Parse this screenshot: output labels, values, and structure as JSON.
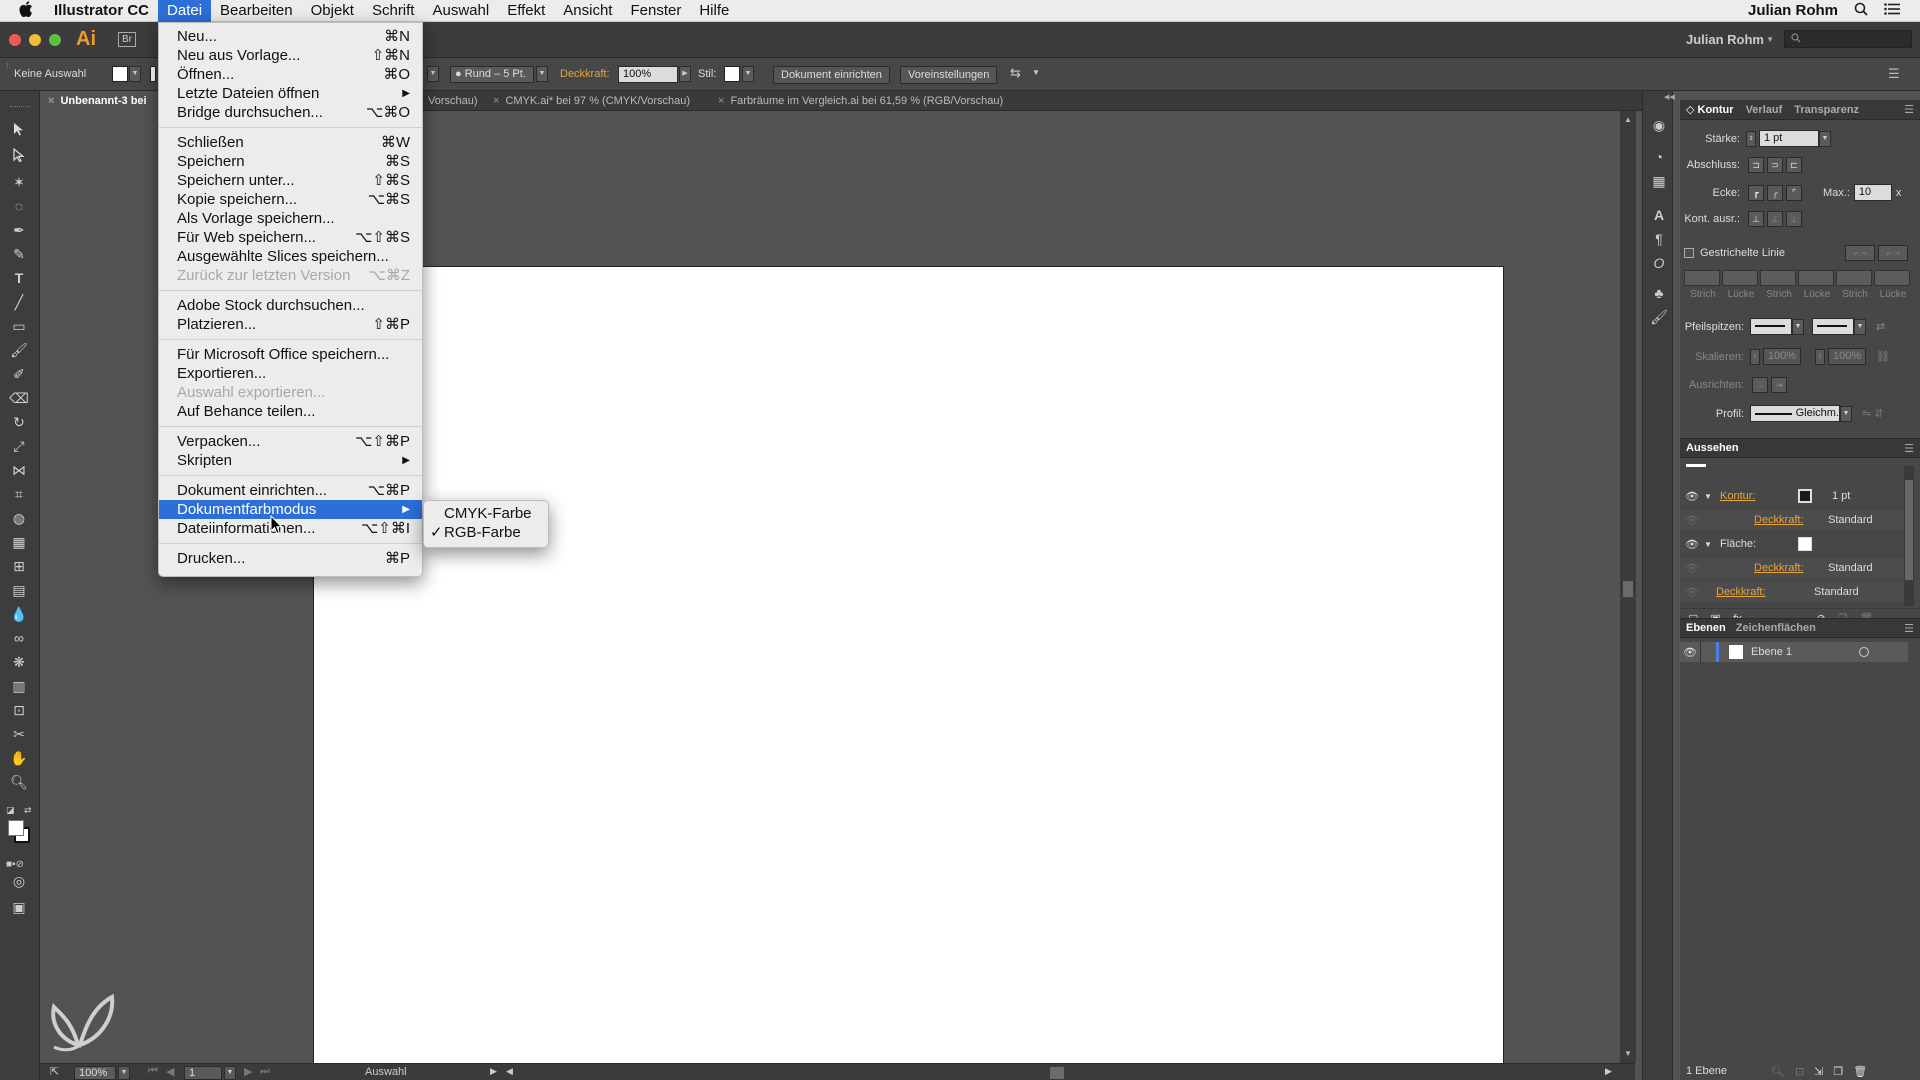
{
  "menubar": {
    "app_name": "Illustrator CC",
    "items": [
      "Datei",
      "Bearbeiten",
      "Objekt",
      "Schrift",
      "Auswahl",
      "Effekt",
      "Ansicht",
      "Fenster",
      "Hilfe"
    ],
    "user": "Julian Rohm"
  },
  "appbar": {
    "logo": "Ai",
    "bridge": "Br",
    "user": "Julian Rohm",
    "search_placeholder": ""
  },
  "controlbar": {
    "selection": "Keine Auswahl",
    "brush": "Rund – 5 Pt.",
    "opacity_label": "Deckkraft:",
    "opacity_value": "100%",
    "style_label": "Stil:",
    "doc_setup": "Dokument einrichten",
    "preferences": "Voreinstellungen"
  },
  "tabs": [
    {
      "label": "Unbenannt-3 bei",
      "active": true
    },
    {
      "label": "Vorschau)",
      "active": false
    },
    {
      "label": "CMYK.ai* bei 97 % (CMYK/Vorschau)",
      "active": false
    },
    {
      "label": "Farbräume im Vergleich.ai bei 61,59 % (RGB/Vorschau)",
      "active": false
    }
  ],
  "datei_menu": [
    {
      "label": "Neu...",
      "shortcut": "⌘N"
    },
    {
      "label": "Neu aus Vorlage...",
      "shortcut": "⇧⌘N"
    },
    {
      "label": "Öffnen...",
      "shortcut": "⌘O"
    },
    {
      "label": "Letzte Dateien öffnen",
      "submenu": true
    },
    {
      "label": "Bridge durchsuchen...",
      "shortcut": "⌥⌘O"
    },
    {
      "sep": true
    },
    {
      "label": "Schließen",
      "shortcut": "⌘W"
    },
    {
      "label": "Speichern",
      "shortcut": "⌘S"
    },
    {
      "label": "Speichern unter...",
      "shortcut": "⇧⌘S"
    },
    {
      "label": "Kopie speichern...",
      "shortcut": "⌥⌘S"
    },
    {
      "label": "Als Vorlage speichern..."
    },
    {
      "label": "Für Web speichern...",
      "shortcut": "⌥⇧⌘S"
    },
    {
      "label": "Ausgewählte Slices speichern..."
    },
    {
      "label": "Zurück zur letzten Version",
      "shortcut": "⌥⌘Z",
      "disabled": true
    },
    {
      "sep": true
    },
    {
      "label": "Adobe Stock durchsuchen..."
    },
    {
      "label": "Platzieren...",
      "shortcut": "⇧⌘P"
    },
    {
      "sep": true
    },
    {
      "label": "Für Microsoft Office speichern..."
    },
    {
      "label": "Exportieren..."
    },
    {
      "label": "Auswahl exportieren...",
      "disabled": true
    },
    {
      "label": "Auf Behance teilen..."
    },
    {
      "sep": true
    },
    {
      "label": "Verpacken...",
      "shortcut": "⌥⇧⌘P"
    },
    {
      "label": "Skripten",
      "submenu": true
    },
    {
      "sep": true
    },
    {
      "label": "Dokument einrichten...",
      "shortcut": "⌥⌘P"
    },
    {
      "label": "Dokumentfarbmodus",
      "submenu": true,
      "highlighted": true
    },
    {
      "label": "Dateiinformationen...",
      "shortcut": "⌥⇧⌘I"
    },
    {
      "sep": true
    },
    {
      "label": "Drucken...",
      "shortcut": "⌘P"
    }
  ],
  "submenu": [
    {
      "label": "CMYK-Farbe",
      "checked": false
    },
    {
      "label": "RGB-Farbe",
      "checked": true
    }
  ],
  "panel_kontur": {
    "tabs": [
      "Kontur",
      "Verlauf",
      "Transparenz"
    ],
    "staerke_label": "Stärke:",
    "staerke_value": "1 pt",
    "abschluss_label": "Abschluss:",
    "ecke_label": "Ecke:",
    "max_label": "Max.:",
    "max_value": "10",
    "max_unit": "x",
    "kont_label": "Kont. ausr.:",
    "dashed_label": "Gestrichelte Linie",
    "dash_labels": [
      "Strich",
      "Lücke",
      "Strich",
      "Lücke",
      "Strich",
      "Lücke"
    ],
    "pfeil_label": "Pfeilspitzen:",
    "skalieren_label": "Skalieren:",
    "skalieren_values": [
      "100%",
      "100%"
    ],
    "ausrichten_label": "Ausrichten:",
    "profil_label": "Profil:",
    "profil_value": "Gleichm."
  },
  "panel_aussehen": {
    "title": "Aussehen",
    "rows": [
      {
        "label": "Kontur:",
        "value": "1 pt"
      },
      {
        "label": "Deckkraft:",
        "value": "Standard"
      },
      {
        "label": "Fläche:",
        "value": ""
      },
      {
        "label": "Deckkraft:",
        "value": "Standard"
      },
      {
        "label": "Deckkraft:",
        "value": "Standard"
      }
    ],
    "fx": "fx."
  },
  "panel_ebenen": {
    "tabs": [
      "Ebenen",
      "Zeichenflächen"
    ],
    "layer": "Ebene 1",
    "count": "1 Ebene"
  },
  "statusbar": {
    "zoom": "100%",
    "page": "1",
    "mode": "Auswahl"
  }
}
